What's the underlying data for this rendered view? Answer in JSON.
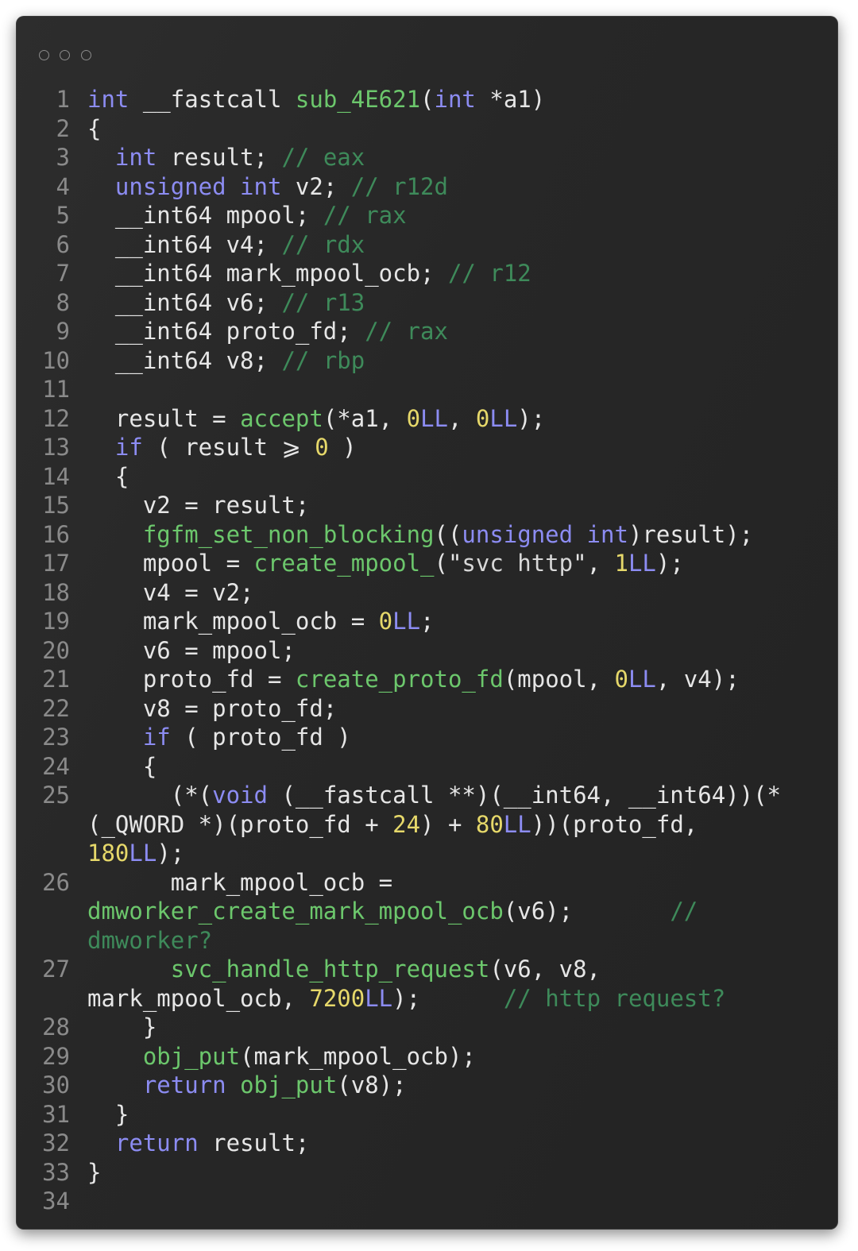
{
  "window": {
    "controls": [
      "close",
      "minimize",
      "maximize"
    ]
  },
  "colors": {
    "background": "#262626",
    "keyword": "#8c8cf2",
    "function": "#6cc76c",
    "comment": "#3e8a5a",
    "number": "#e6d86a",
    "text": "#e6e6e6",
    "line_number": "#8a8a8a"
  },
  "code": {
    "lines": [
      {
        "n": "1",
        "tokens": [
          [
            "kw",
            "int"
          ],
          [
            "t",
            " __fastcall "
          ],
          [
            "fn",
            "sub_4E621"
          ],
          [
            "t",
            "("
          ],
          [
            "kw",
            "int"
          ],
          [
            "t",
            " *a1)"
          ]
        ]
      },
      {
        "n": "2",
        "tokens": [
          [
            "t",
            "{"
          ]
        ]
      },
      {
        "n": "3",
        "tokens": [
          [
            "t",
            "  "
          ],
          [
            "kw",
            "int"
          ],
          [
            "t",
            " result; "
          ],
          [
            "cm",
            "// eax"
          ]
        ]
      },
      {
        "n": "4",
        "tokens": [
          [
            "t",
            "  "
          ],
          [
            "kw",
            "unsigned int"
          ],
          [
            "t",
            " v2; "
          ],
          [
            "cm",
            "// r12d"
          ]
        ]
      },
      {
        "n": "5",
        "tokens": [
          [
            "t",
            "  __int64 mpool; "
          ],
          [
            "cm",
            "// rax"
          ]
        ]
      },
      {
        "n": "6",
        "tokens": [
          [
            "t",
            "  __int64 v4; "
          ],
          [
            "cm",
            "// rdx"
          ]
        ]
      },
      {
        "n": "7",
        "tokens": [
          [
            "t",
            "  __int64 mark_mpool_ocb; "
          ],
          [
            "cm",
            "// r12"
          ]
        ]
      },
      {
        "n": "8",
        "tokens": [
          [
            "t",
            "  __int64 v6; "
          ],
          [
            "cm",
            "// r13"
          ]
        ]
      },
      {
        "n": "9",
        "tokens": [
          [
            "t",
            "  __int64 proto_fd; "
          ],
          [
            "cm",
            "// rax"
          ]
        ]
      },
      {
        "n": "10",
        "tokens": [
          [
            "t",
            "  __int64 v8; "
          ],
          [
            "cm",
            "// rbp"
          ]
        ]
      },
      {
        "n": "11",
        "tokens": []
      },
      {
        "n": "12",
        "tokens": [
          [
            "t",
            "  result = "
          ],
          [
            "fn",
            "accept"
          ],
          [
            "t",
            "(*a1, "
          ],
          [
            "num",
            "0"
          ],
          [
            "suf",
            "LL"
          ],
          [
            "t",
            ", "
          ],
          [
            "num",
            "0"
          ],
          [
            "suf",
            "LL"
          ],
          [
            "t",
            ");"
          ]
        ]
      },
      {
        "n": "13",
        "tokens": [
          [
            "t",
            "  "
          ],
          [
            "kw",
            "if"
          ],
          [
            "t",
            " ( result ⩾ "
          ],
          [
            "num",
            "0"
          ],
          [
            "t",
            " )"
          ]
        ]
      },
      {
        "n": "14",
        "tokens": [
          [
            "t",
            "  {"
          ]
        ]
      },
      {
        "n": "15",
        "tokens": [
          [
            "t",
            "    v2 = result;"
          ]
        ]
      },
      {
        "n": "16",
        "tokens": [
          [
            "t",
            "    "
          ],
          [
            "fn",
            "fgfm_set_non_blocking"
          ],
          [
            "t",
            "(("
          ],
          [
            "kw",
            "unsigned int"
          ],
          [
            "t",
            ")result);"
          ]
        ]
      },
      {
        "n": "17",
        "tokens": [
          [
            "t",
            "    mpool = "
          ],
          [
            "fn",
            "create_mpool_"
          ],
          [
            "t",
            "(\""
          ],
          [
            "str",
            "svc http"
          ],
          [
            "t",
            "\", "
          ],
          [
            "num",
            "1"
          ],
          [
            "suf",
            "LL"
          ],
          [
            "t",
            ");"
          ]
        ]
      },
      {
        "n": "18",
        "tokens": [
          [
            "t",
            "    v4 = v2;"
          ]
        ]
      },
      {
        "n": "19",
        "tokens": [
          [
            "t",
            "    mark_mpool_ocb = "
          ],
          [
            "num",
            "0"
          ],
          [
            "suf",
            "LL"
          ],
          [
            "t",
            ";"
          ]
        ]
      },
      {
        "n": "20",
        "tokens": [
          [
            "t",
            "    v6 = mpool;"
          ]
        ]
      },
      {
        "n": "21",
        "tokens": [
          [
            "t",
            "    proto_fd = "
          ],
          [
            "fn",
            "create_proto_fd"
          ],
          [
            "t",
            "(mpool, "
          ],
          [
            "num",
            "0"
          ],
          [
            "suf",
            "LL"
          ],
          [
            "t",
            ", v4);"
          ]
        ]
      },
      {
        "n": "22",
        "tokens": [
          [
            "t",
            "    v8 = proto_fd;"
          ]
        ]
      },
      {
        "n": "23",
        "tokens": [
          [
            "t",
            "    "
          ],
          [
            "kw",
            "if"
          ],
          [
            "t",
            " ( proto_fd )"
          ]
        ]
      },
      {
        "n": "24",
        "tokens": [
          [
            "t",
            "    {"
          ]
        ]
      },
      {
        "n": "25",
        "tokens": [
          [
            "t",
            "      (*("
          ],
          [
            "kw",
            "void"
          ],
          [
            "t",
            " (__fastcall **)(__int64, __int64))(*\n(_QWORD *)(proto_fd + "
          ],
          [
            "num",
            "24"
          ],
          [
            "t",
            ") + "
          ],
          [
            "num",
            "80"
          ],
          [
            "suf",
            "LL"
          ],
          [
            "t",
            "))(proto_fd,\n"
          ],
          [
            "num",
            "180"
          ],
          [
            "suf",
            "LL"
          ],
          [
            "t",
            ");"
          ]
        ]
      },
      {
        "n": "26",
        "tokens": [
          [
            "t",
            "      mark_mpool_ocb =\n"
          ],
          [
            "fn",
            "dmworker_create_mark_mpool_ocb"
          ],
          [
            "t",
            "(v6);       "
          ],
          [
            "cm",
            "//\ndmworker?"
          ]
        ]
      },
      {
        "n": "27",
        "tokens": [
          [
            "t",
            "      "
          ],
          [
            "fn",
            "svc_handle_http_request"
          ],
          [
            "t",
            "(v6, v8,\nmark_mpool_ocb, "
          ],
          [
            "num",
            "7200"
          ],
          [
            "suf",
            "LL"
          ],
          [
            "t",
            ");      "
          ],
          [
            "cm",
            "// http request?"
          ]
        ]
      },
      {
        "n": "28",
        "tokens": [
          [
            "t",
            "    }"
          ]
        ]
      },
      {
        "n": "29",
        "tokens": [
          [
            "t",
            "    "
          ],
          [
            "fn",
            "obj_put"
          ],
          [
            "t",
            "(mark_mpool_ocb);"
          ]
        ]
      },
      {
        "n": "30",
        "tokens": [
          [
            "t",
            "    "
          ],
          [
            "kw",
            "return"
          ],
          [
            "t",
            " "
          ],
          [
            "fn",
            "obj_put"
          ],
          [
            "t",
            "(v8);"
          ]
        ]
      },
      {
        "n": "31",
        "tokens": [
          [
            "t",
            "  }"
          ]
        ]
      },
      {
        "n": "32",
        "tokens": [
          [
            "t",
            "  "
          ],
          [
            "kw",
            "return"
          ],
          [
            "t",
            " result;"
          ]
        ]
      },
      {
        "n": "33",
        "tokens": [
          [
            "t",
            "}"
          ]
        ]
      },
      {
        "n": "34",
        "tokens": []
      }
    ]
  }
}
